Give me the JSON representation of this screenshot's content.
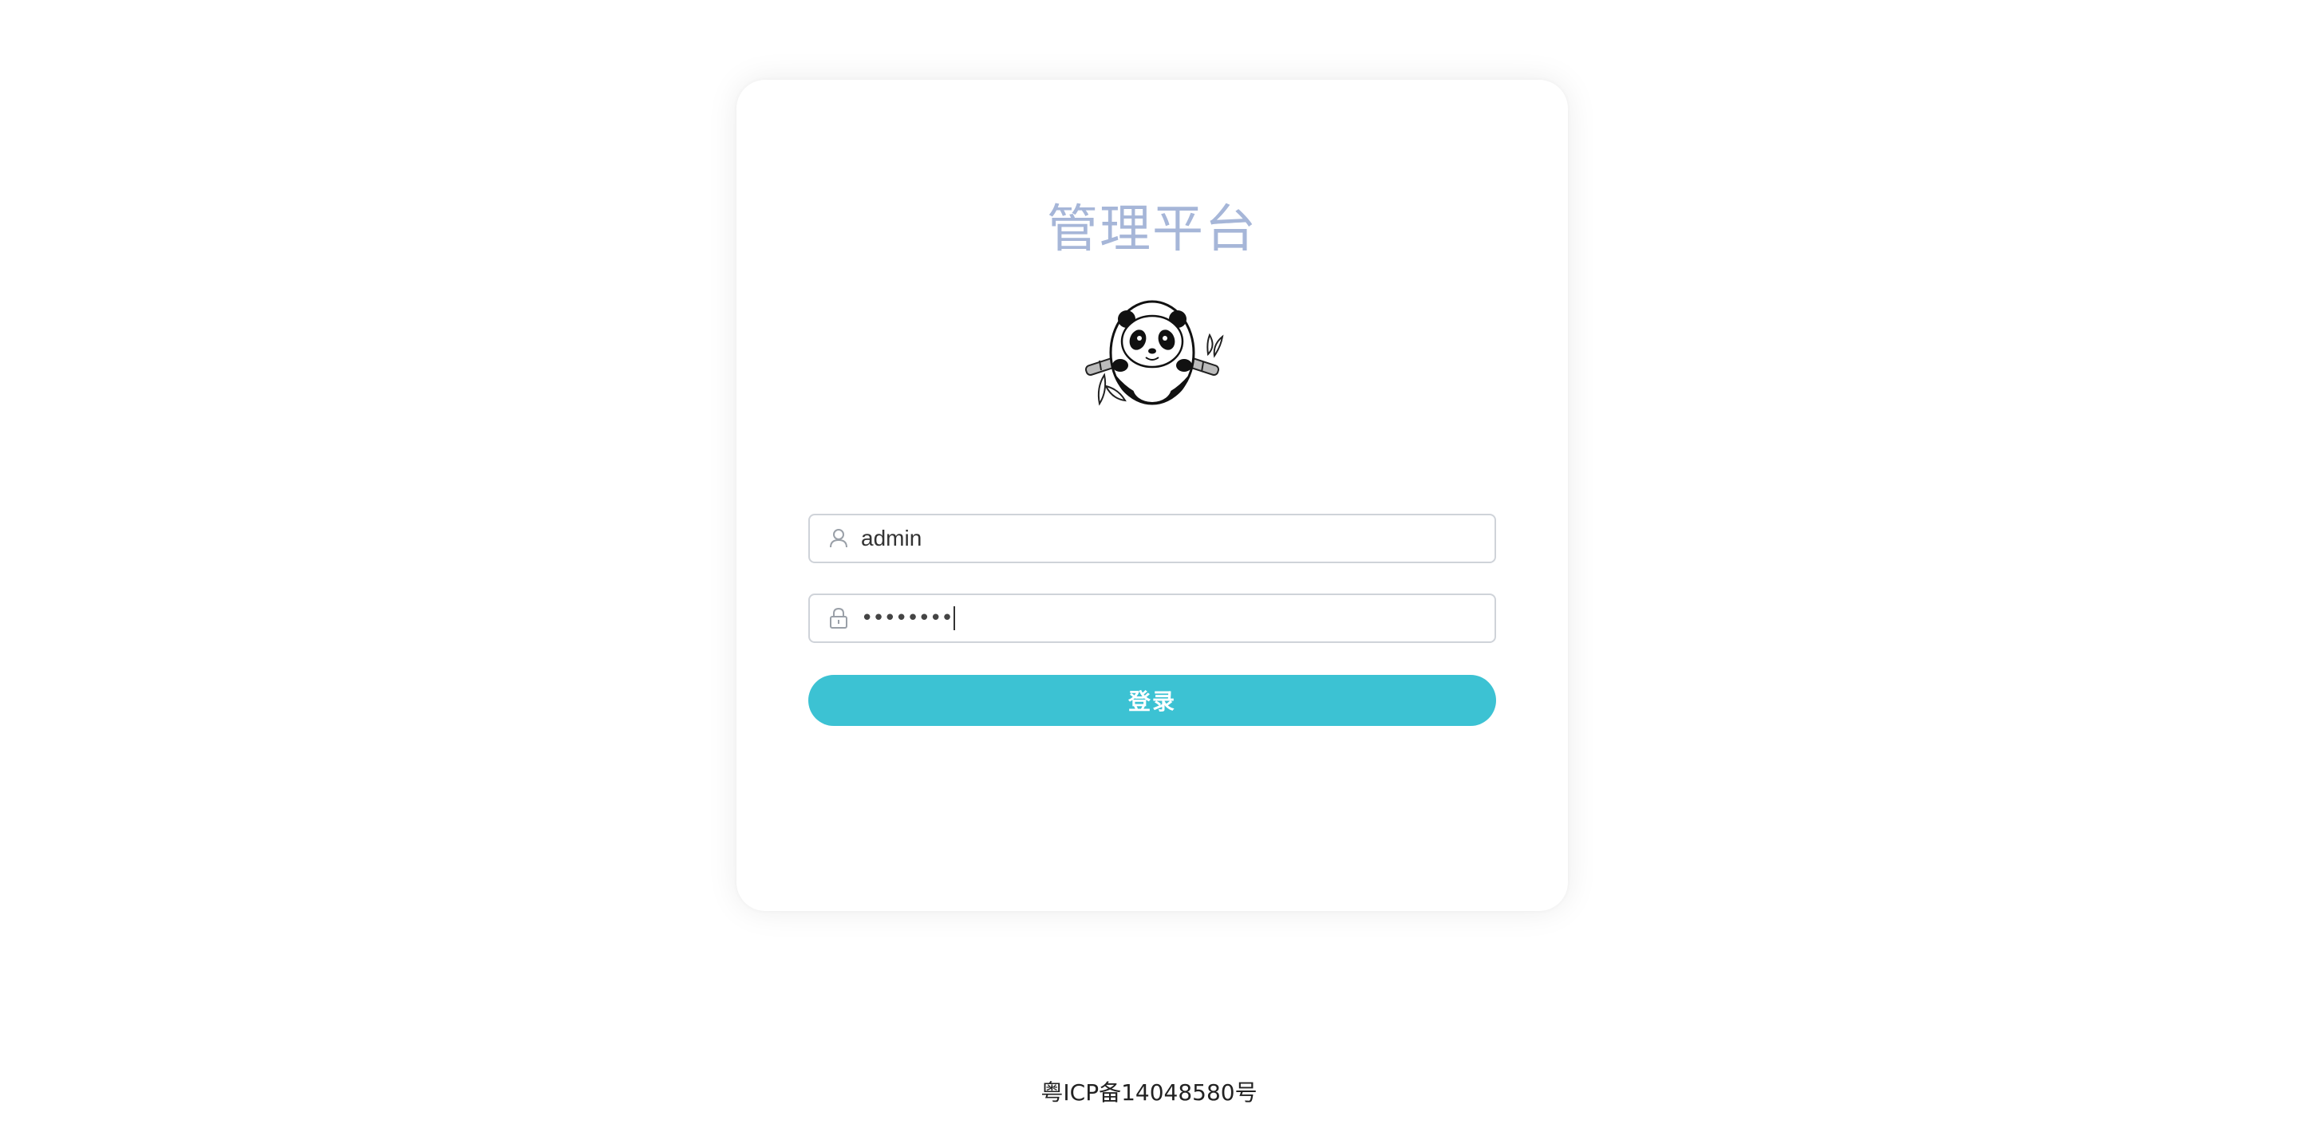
{
  "app": {
    "title": "管理平台"
  },
  "logo": {
    "icon": "panda-bamboo-logo"
  },
  "form": {
    "username": {
      "value": "admin",
      "icon": "user-icon"
    },
    "password": {
      "masked_value": "••••••••",
      "icon": "lock-icon"
    },
    "login_label": "登录"
  },
  "footer": {
    "icp": "粤ICP备14048580号"
  },
  "colors": {
    "title": "#a6b6d8",
    "accent": "#3cc2d3",
    "border": "#cfd3d9"
  }
}
